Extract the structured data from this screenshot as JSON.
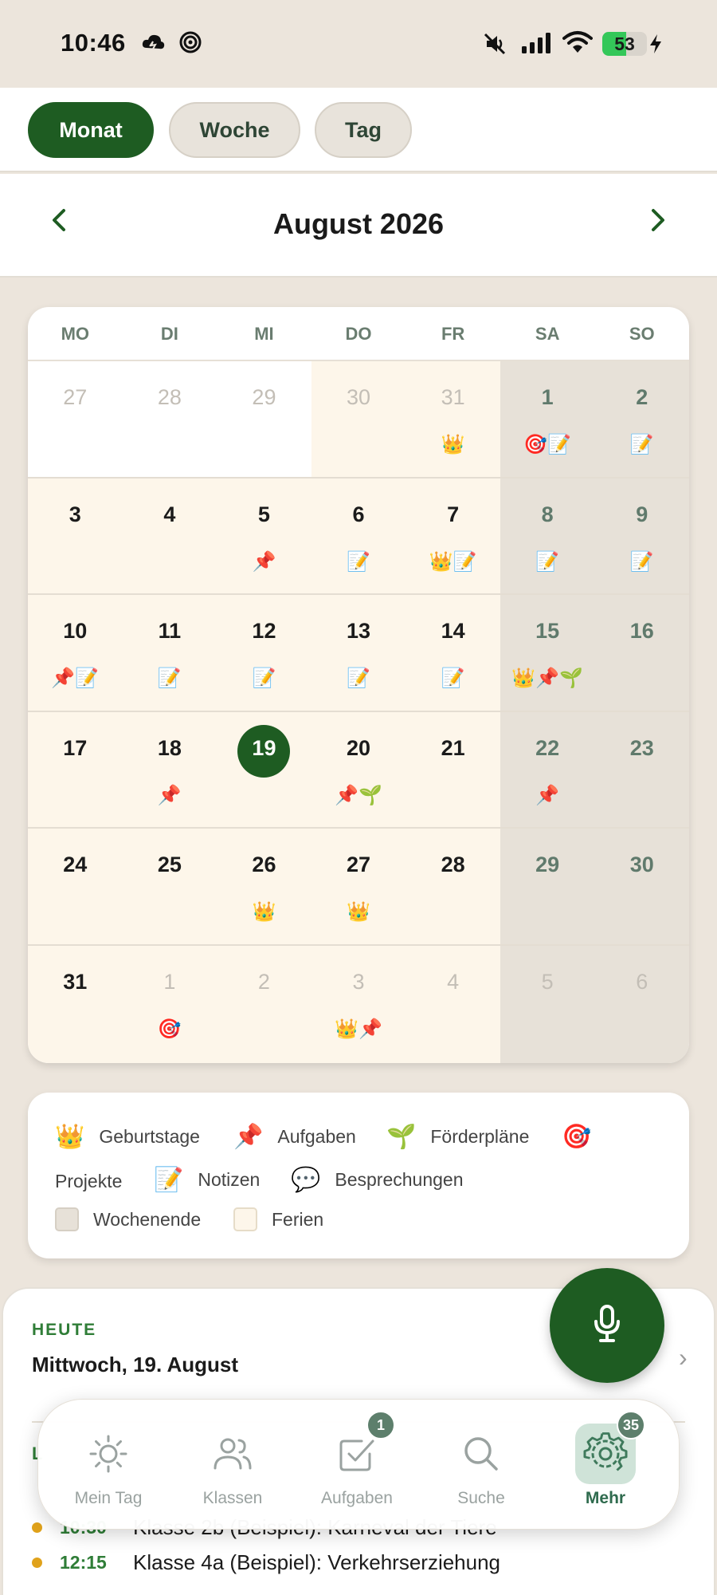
{
  "status_bar": {
    "time": "10:46",
    "battery": "53",
    "battery_level": 0.53,
    "icons": [
      "cloud-icon",
      "swirl-icon",
      "mute-icon",
      "signal-icon",
      "wifi-icon",
      "battery-icon",
      "charging-icon"
    ]
  },
  "view_tabs": [
    {
      "label": "Monat",
      "active": true
    },
    {
      "label": "Woche",
      "active": false
    },
    {
      "label": "Tag",
      "active": false
    }
  ],
  "header": {
    "month_title": "August 2026",
    "prev_icon": "chevron-left-icon",
    "next_icon": "chevron-right-icon"
  },
  "calendar": {
    "weekdays": [
      "MO",
      "DI",
      "MI",
      "DO",
      "FR",
      "SA",
      "SO"
    ],
    "weeks": [
      [
        {
          "num": "27",
          "muted": true,
          "bg": "out",
          "icons": ""
        },
        {
          "num": "28",
          "muted": true,
          "bg": "out",
          "icons": ""
        },
        {
          "num": "29",
          "muted": true,
          "bg": "out",
          "icons": ""
        },
        {
          "num": "30",
          "muted": true,
          "bg": "ferien",
          "icons": ""
        },
        {
          "num": "31",
          "muted": true,
          "bg": "ferien",
          "icons": "👑"
        },
        {
          "num": "1",
          "muted": false,
          "bg": "weekend",
          "icons": "🎯📝"
        },
        {
          "num": "2",
          "muted": false,
          "bg": "weekend",
          "icons": "📝"
        }
      ],
      [
        {
          "num": "3",
          "muted": false,
          "bg": "ferien",
          "icons": ""
        },
        {
          "num": "4",
          "muted": false,
          "bg": "ferien",
          "icons": ""
        },
        {
          "num": "5",
          "muted": false,
          "bg": "ferien",
          "icons": "📌"
        },
        {
          "num": "6",
          "muted": false,
          "bg": "ferien",
          "icons": "📝"
        },
        {
          "num": "7",
          "muted": false,
          "bg": "ferien",
          "icons": "👑📝"
        },
        {
          "num": "8",
          "muted": false,
          "bg": "weekend",
          "icons": "📝"
        },
        {
          "num": "9",
          "muted": false,
          "bg": "weekend",
          "icons": "📝"
        }
      ],
      [
        {
          "num": "10",
          "muted": false,
          "bg": "ferien",
          "icons": "📌📝"
        },
        {
          "num": "11",
          "muted": false,
          "bg": "ferien",
          "icons": "📝"
        },
        {
          "num": "12",
          "muted": false,
          "bg": "ferien",
          "icons": "📝"
        },
        {
          "num": "13",
          "muted": false,
          "bg": "ferien",
          "icons": "📝"
        },
        {
          "num": "14",
          "muted": false,
          "bg": "ferien",
          "icons": "📝"
        },
        {
          "num": "15",
          "muted": false,
          "bg": "weekend",
          "icons": "👑📌🌱"
        },
        {
          "num": "16",
          "muted": false,
          "bg": "weekend",
          "icons": ""
        }
      ],
      [
        {
          "num": "17",
          "muted": false,
          "bg": "ferien",
          "icons": ""
        },
        {
          "num": "18",
          "muted": false,
          "bg": "ferien",
          "icons": "📌"
        },
        {
          "num": "19",
          "muted": false,
          "bg": "ferien",
          "icons": "",
          "today": true
        },
        {
          "num": "20",
          "muted": false,
          "bg": "ferien",
          "icons": "📌🌱"
        },
        {
          "num": "21",
          "muted": false,
          "bg": "ferien",
          "icons": ""
        },
        {
          "num": "22",
          "muted": false,
          "bg": "weekend",
          "icons": "📌"
        },
        {
          "num": "23",
          "muted": false,
          "bg": "weekend",
          "icons": ""
        }
      ],
      [
        {
          "num": "24",
          "muted": false,
          "bg": "ferien",
          "icons": ""
        },
        {
          "num": "25",
          "muted": false,
          "bg": "ferien",
          "icons": ""
        },
        {
          "num": "26",
          "muted": false,
          "bg": "ferien",
          "icons": "👑"
        },
        {
          "num": "27",
          "muted": false,
          "bg": "ferien",
          "icons": "👑"
        },
        {
          "num": "28",
          "muted": false,
          "bg": "ferien",
          "icons": ""
        },
        {
          "num": "29",
          "muted": false,
          "bg": "weekend",
          "icons": ""
        },
        {
          "num": "30",
          "muted": false,
          "bg": "weekend",
          "icons": ""
        }
      ],
      [
        {
          "num": "31",
          "muted": false,
          "bg": "ferien",
          "icons": ""
        },
        {
          "num": "1",
          "muted": true,
          "bg": "ferien",
          "icons": "🎯"
        },
        {
          "num": "2",
          "muted": true,
          "bg": "ferien",
          "icons": ""
        },
        {
          "num": "3",
          "muted": true,
          "bg": "ferien",
          "icons": "👑📌"
        },
        {
          "num": "4",
          "muted": true,
          "bg": "ferien",
          "icons": ""
        },
        {
          "num": "5",
          "muted": true,
          "bg": "weekend",
          "icons": ""
        },
        {
          "num": "6",
          "muted": true,
          "bg": "weekend",
          "icons": ""
        }
      ]
    ]
  },
  "legend": {
    "geburtstage": {
      "emoji": "👑",
      "label": "Geburtstage"
    },
    "aufgaben": {
      "emoji": "📌",
      "label": "Aufgaben"
    },
    "foerderplaene": {
      "emoji": "🌱",
      "label": "Förderpläne"
    },
    "projekte": {
      "emoji": "🎯",
      "label": "Projekte"
    },
    "notizen": {
      "emoji": "📝",
      "label": "Notizen"
    },
    "besprechungen": {
      "emoji": "💬",
      "label": "Besprechungen"
    },
    "wochenende": {
      "label": "Wochenende",
      "color": "#e7e1d8"
    },
    "ferien": {
      "label": "Ferien",
      "color": "#fdf6ea"
    }
  },
  "today": {
    "label": "HEUTE",
    "date": "Mittwoch, 19. August",
    "partial_label": "L",
    "events": [
      {
        "time": "10:30",
        "title": "Klasse 2b (Beispiel): Karneval der Tiere"
      },
      {
        "time": "12:15",
        "title": "Klasse 4a (Beispiel): Verkehrserziehung"
      }
    ]
  },
  "fab": {
    "icon": "microphone-icon"
  },
  "bottom_nav": [
    {
      "label": "Mein Tag",
      "icon": "sun-icon",
      "badge": "",
      "active": false
    },
    {
      "label": "Klassen",
      "icon": "users-icon",
      "badge": "",
      "active": false
    },
    {
      "label": "Aufgaben",
      "icon": "checkbox-icon",
      "badge": "1",
      "active": false
    },
    {
      "label": "Suche",
      "icon": "search-icon",
      "badge": "",
      "active": false
    },
    {
      "label": "Mehr",
      "icon": "gear-icon",
      "badge": "35",
      "active": true
    }
  ],
  "colors": {
    "primary": "#1e5c22",
    "accent_green": "#2f7d37",
    "event_dot": "#e0a21b",
    "app_bg": "#ece5dc"
  }
}
